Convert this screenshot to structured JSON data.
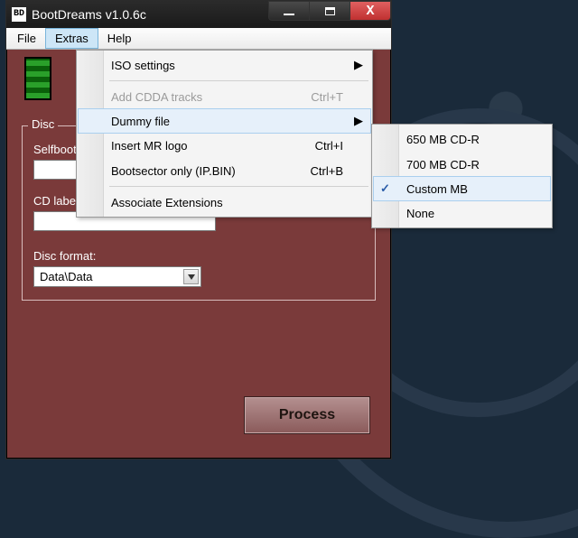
{
  "window": {
    "icon_text": "BD",
    "title": "BootDreams v1.0.6c"
  },
  "menubar": {
    "file": "File",
    "extras": "Extras",
    "help": "Help"
  },
  "extras_menu": {
    "iso_settings": "ISO settings",
    "add_cdda": "Add CDDA tracks",
    "add_cdda_sc": "Ctrl+T",
    "dummy_file": "Dummy file",
    "insert_mr": "Insert MR logo",
    "insert_mr_sc": "Ctrl+I",
    "bootsector": "Bootsector only (IP.BIN)",
    "bootsector_sc": "Ctrl+B",
    "assoc_ext": "Associate Extensions"
  },
  "dummy_submenu": {
    "cd650": "650 MB CD-R",
    "cd700": "700 MB CD-R",
    "custom": "Custom MB",
    "none": "None"
  },
  "form": {
    "group_title": "Disc",
    "selfboot_label": "Selfboot folder:",
    "selfboot_value": "",
    "cdlabel_label": "CD label:",
    "cdlabel_value": "",
    "discformat_label": "Disc format:",
    "discformat_value": "Data\\Data"
  },
  "buttons": {
    "process": "Process"
  }
}
